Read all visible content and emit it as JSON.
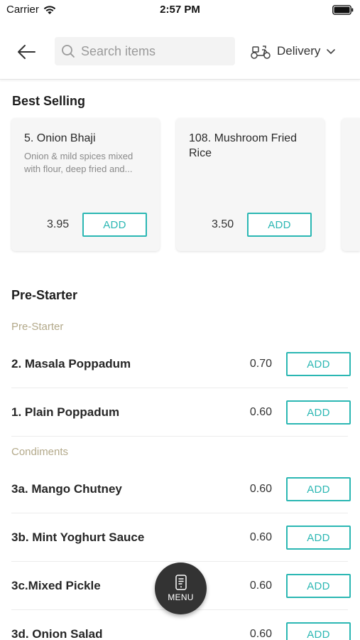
{
  "status_bar": {
    "carrier": "Carrier",
    "time": "2:57 PM"
  },
  "header": {
    "back_icon": "arrow-left-icon",
    "search": {
      "placeholder": "Search items",
      "value": ""
    },
    "delivery_label": "Delivery"
  },
  "best_selling": {
    "title": "Best Selling",
    "items": [
      {
        "name": "5. Onion Bhaji",
        "description": "Onion & mild spices mixed with flour, deep fried and...",
        "price": "3.95",
        "add_label": "ADD"
      },
      {
        "name": "108. Mushroom Fried Rice",
        "description": "",
        "price": "3.50",
        "add_label": "ADD"
      }
    ]
  },
  "menu": {
    "category": "Pre-Starter",
    "groups": [
      {
        "subcategory": "Pre-Starter",
        "items": [
          {
            "name": "2. Masala Poppadum",
            "price": "0.70",
            "add_label": "ADD"
          },
          {
            "name": "1. Plain Poppadum",
            "price": "0.60",
            "add_label": "ADD"
          }
        ]
      },
      {
        "subcategory": "Condiments",
        "items": [
          {
            "name": "3a. Mango Chutney",
            "price": "0.60",
            "add_label": "ADD"
          },
          {
            "name": "3b. Mint Yoghurt Sauce",
            "price": "0.60",
            "add_label": "ADD"
          },
          {
            "name": "3c.Mixed Pickle",
            "price": "0.60",
            "add_label": "ADD"
          },
          {
            "name": "3d. Onion Salad",
            "price": "0.60",
            "add_label": "ADD"
          }
        ]
      }
    ]
  },
  "fab": {
    "label": "MENU",
    "icon": "menu-book-icon"
  },
  "colors": {
    "accent": "#2bb7b3",
    "subcategory": "#b3a98a",
    "fab": "#333333"
  }
}
